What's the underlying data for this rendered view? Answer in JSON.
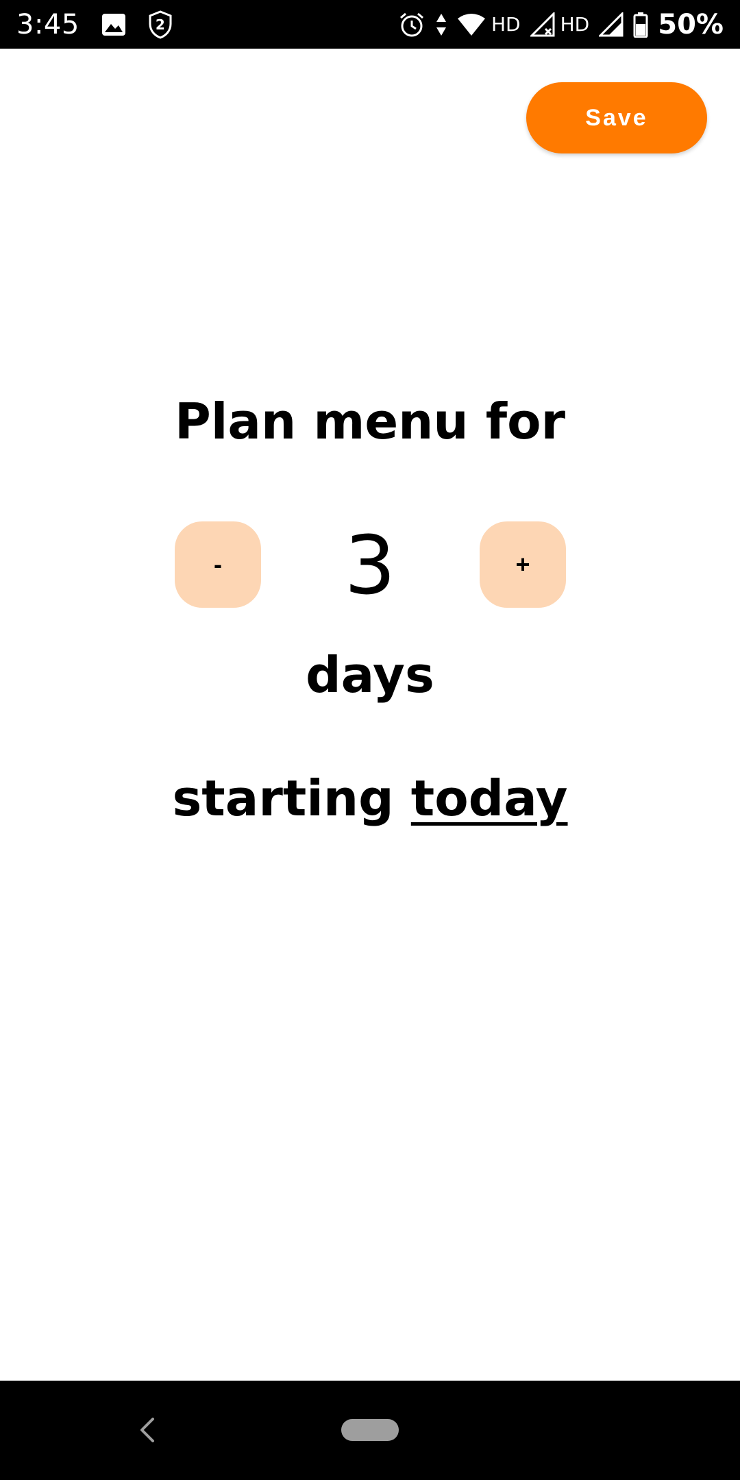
{
  "status_bar": {
    "time": "3:45",
    "left_icons": [
      "image-icon",
      "shield-badge-icon"
    ],
    "shield_badge_number": "2",
    "right_icons": [
      "alarm-icon",
      "data-arrows-icon",
      "wifi-icon",
      "signal-icon",
      "signal-icon"
    ],
    "hd_label_1": "HD",
    "hd_label_2": "HD",
    "battery": "50%"
  },
  "toolbar": {
    "save_label": "Save"
  },
  "planner": {
    "heading": "Plan menu for",
    "minus_label": "-",
    "plus_label": "+",
    "days_value": "3",
    "days_label": "days",
    "starting_prefix": "starting",
    "starting_value": "today"
  },
  "nav_bar": {
    "icons": [
      "back-icon",
      "home-pill-icon"
    ]
  },
  "colors": {
    "accent": "#ff7a00",
    "stepper_bg": "#fdd6b4",
    "status_bar_bg": "#000000",
    "nav_bar_bg": "#000000",
    "home_pill": "#9e9e9e"
  }
}
